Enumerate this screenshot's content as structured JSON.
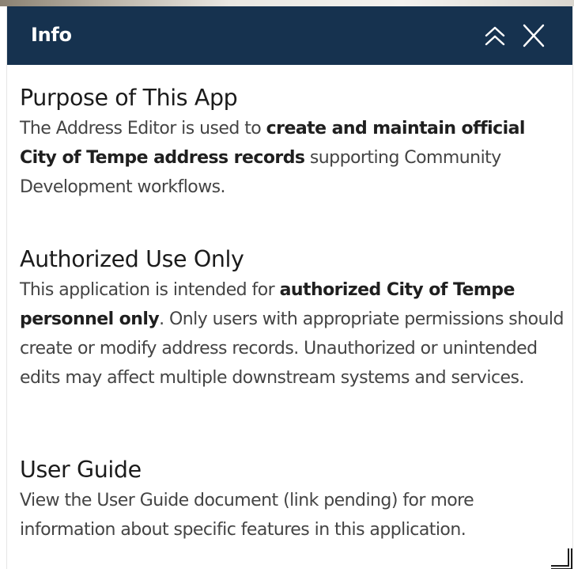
{
  "panel": {
    "title": "Info",
    "header_color": "#16324f",
    "collapse_icon": "double-chevron-up-icon",
    "close_icon": "close-icon",
    "resize_icon": "resize-corner-icon"
  },
  "sections": [
    {
      "heading": "Purpose of This App",
      "body": {
        "part1": "The Address Editor is used to ",
        "bold1": "create and maintain official City of Tempe address records",
        "part2": " supporting Community Development workflows."
      }
    },
    {
      "heading": "Authorized Use Only",
      "body": {
        "part1": "This application is intended for ",
        "bold1": "authorized City of Tempe personnel only",
        "part2": ". Only users with appropriate permissions should create or modify address records. Unauthorized or unintended edits may affect multiple downstream systems and services."
      }
    },
    {
      "heading": "User Guide",
      "body": {
        "part1": "View the User Guide document (link pending) for more information about specific features in this application."
      }
    }
  ]
}
